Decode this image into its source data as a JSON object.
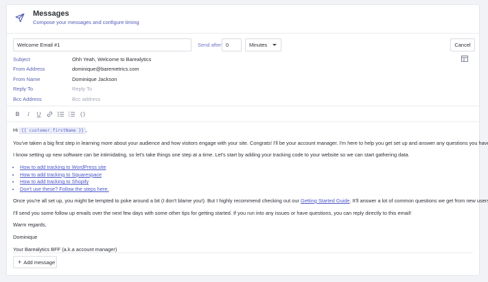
{
  "header": {
    "title": "Messages",
    "subtitle": "Compose your messages and configure timing",
    "icon": "paper-plane-icon"
  },
  "controls": {
    "message_name": "Welcome Email #1",
    "send_after_label": "Send after",
    "send_after_value": "0",
    "unit_value": "Minutes",
    "cancel_label": "Cancel"
  },
  "meta": {
    "subject_label": "Subject",
    "subject_value": "Ohh Yeah, Welcome to Barealytics",
    "from_address_label": "From Address",
    "from_address_value": "dominique@baremetrics.com",
    "from_name_label": "From Name",
    "from_name_value": "Dominique Jackson",
    "reply_to_label": "Reply To",
    "reply_to_placeholder": "Reply To",
    "bcc_label": "Bcc Address",
    "bcc_placeholder": "Bcc address"
  },
  "toolbar": {
    "bold": "B",
    "italic": "I",
    "underline": "U",
    "code": "{}"
  },
  "body": {
    "greeting_prefix": "Hi",
    "greeting_tag": "{{ customer.firstName }}",
    "greeting_suffix": ",",
    "para1": "You've taken a big first step in learning more about your audience and how visitors engage with your site. Congrats! I'll be your account manager. I'm here to help you get set up and answer any questions you have!",
    "para2": "I know setting up new software can be intimidating, so let's take things one step at a time. Let's start by adding your tracking code to your website so we can start gathering data.",
    "links": [
      "How to add tracking to WordPress site",
      "How to add tracking to Squarespace",
      "How to add tracking to Shopify",
      "Don't use these? Follow the steps here."
    ],
    "para3_before": "Once you're all set up, you might be tempted to poke around a bit (I don't blame you!). But I highly recommend checking out our",
    "para3_link": "Getting Started Guide",
    "para3_after": ". It'll answer a lot of common questions we get from new users.",
    "para4": "I'll send you some follow up emails over the next few days with some other tips for getting started. If you run into any issues or have questions, you can reply directly to this email!",
    "closing": "Warm regards,",
    "signature_name": "Dominique",
    "signature_title": "Your Barealytics BFF (a.k.a account manager)"
  },
  "footer": {
    "add_message_label": "Add message"
  }
}
